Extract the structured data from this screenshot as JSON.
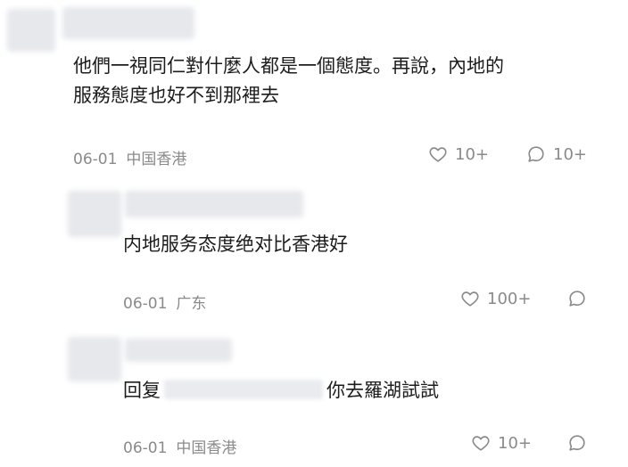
{
  "comments": [
    {
      "lines": [
        "他們一視同仁對什麼人都是一個態度。再說，內地的",
        "服務態度也好不到那裡去"
      ],
      "date": "06-01",
      "location": "中国香港",
      "like_count": "10+",
      "reply_count": "10+"
    },
    {
      "lines": [
        "内地服务态度绝对比香港好"
      ],
      "date": "06-01",
      "location": "广东",
      "like_count": "100+"
    },
    {
      "reply_prefix": "回复",
      "text": "你去羅湖試試",
      "date": "06-01",
      "location": "中国香港",
      "like_count": "10+"
    }
  ],
  "icons": [
    "heart-icon",
    "comment-bubble-icon"
  ],
  "colors": {
    "meta": "#8a8a8a",
    "text": "#1c1c1c",
    "blur": "#e6e8ec"
  }
}
